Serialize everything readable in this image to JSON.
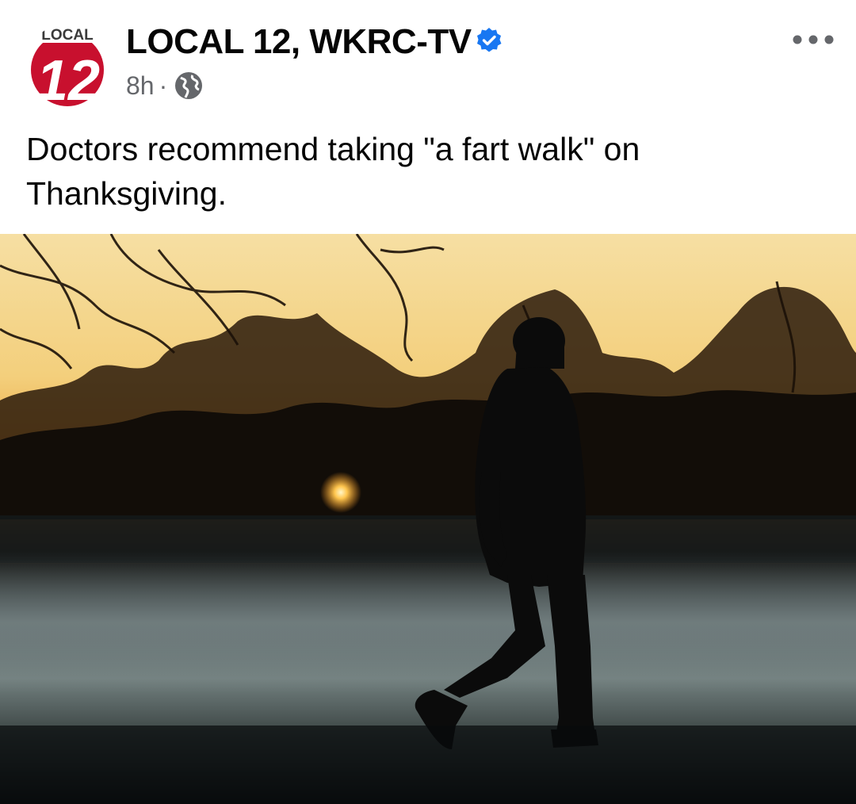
{
  "post": {
    "page_name": "LOCAL 12, WKRC-TV",
    "verified_icon": "verified-badge-icon",
    "timestamp": "8h",
    "separator": "·",
    "audience_icon": "globe-icon",
    "more_icon": "more-options-icon",
    "caption": "Doctors recommend taking \"a fart walk\" on Thanksgiving.",
    "avatar": {
      "logo_text": "LOCAL",
      "logo_number": "12",
      "colors": {
        "red": "#c8102e",
        "white": "#ffffff"
      }
    },
    "photo": {
      "subject": "person-walking-silhouette",
      "colors": {
        "sky_top": "#f6dfa3",
        "sky_glow": "#ef9a2c",
        "fog": "#6f7f82",
        "ground": "#0d1213"
      }
    }
  },
  "colors": {
    "text": "#050505",
    "secondary_text": "#65676b",
    "verified_blue": "#1877f2"
  }
}
